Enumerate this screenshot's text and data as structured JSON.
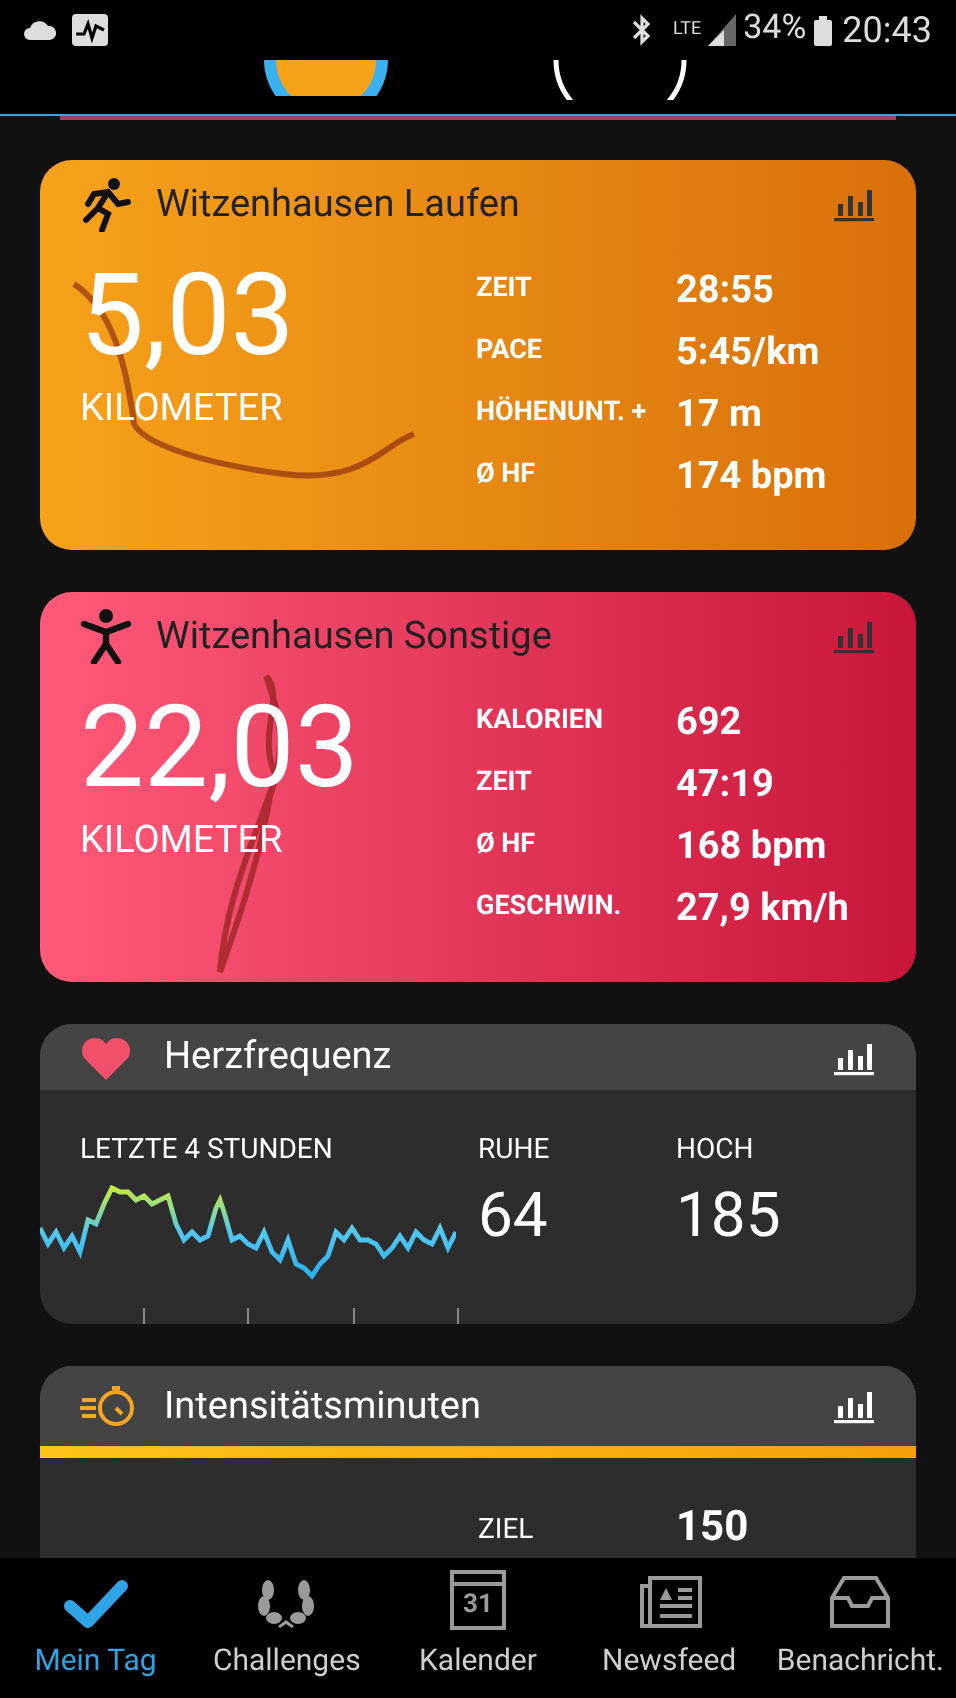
{
  "status_bar": {
    "network": "LTE",
    "battery": "34%",
    "time": "20:43"
  },
  "activities": [
    {
      "kind": "running",
      "title": "Witzenhausen Laufen",
      "distance": "5,03",
      "unit": "KILOMETER",
      "stats": [
        {
          "label": "ZEIT",
          "value": "28:55"
        },
        {
          "label": "PACE",
          "value": "5:45/km"
        },
        {
          "label": "HÖHENUNT. +",
          "value": "17 m"
        },
        {
          "label": "Ø HF",
          "value": "174 bpm"
        }
      ]
    },
    {
      "kind": "other",
      "title": "Witzenhausen Sonstige",
      "distance": "22,03",
      "unit": "KILOMETER",
      "stats": [
        {
          "label": "KALORIEN",
          "value": "692"
        },
        {
          "label": "ZEIT",
          "value": "47:19"
        },
        {
          "label": "Ø HF",
          "value": "168 bpm"
        },
        {
          "label": "GESCHWIN.",
          "value": "27,9 km/h"
        }
      ]
    }
  ],
  "heart_rate": {
    "title": "Herzfrequenz",
    "period_label": "LETZTE 4 STUNDEN",
    "stats": [
      {
        "label": "RUHE",
        "value": "64"
      },
      {
        "label": "HOCH",
        "value": "185"
      }
    ]
  },
  "intensity": {
    "title": "Intensitätsminuten",
    "stats": [
      {
        "label": "ZIEL",
        "value": "150"
      }
    ]
  },
  "nav": [
    {
      "kind": "day",
      "label": "Mein Tag",
      "selected": true
    },
    {
      "kind": "challenges",
      "label": "Challenges",
      "selected": false
    },
    {
      "kind": "calendar",
      "label": "Kalender",
      "icon_text": "31",
      "selected": false
    },
    {
      "kind": "news",
      "label": "Newsfeed",
      "selected": false
    },
    {
      "kind": "inbox",
      "label": "Benachricht.",
      "selected": false
    }
  ]
}
